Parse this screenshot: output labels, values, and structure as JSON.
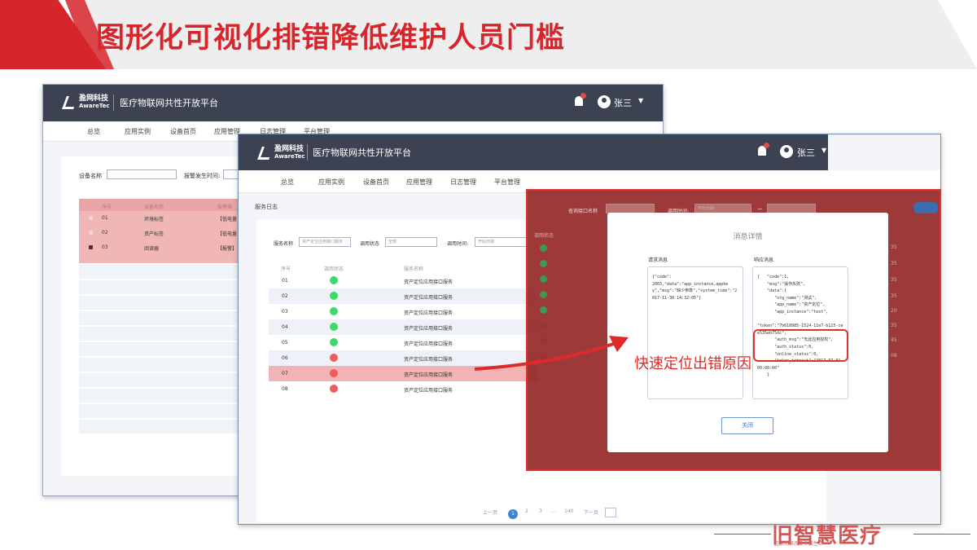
{
  "slide_title": "图形化可视化排错降低维护人员门槛",
  "callout": "快速定位出错原因",
  "colors": {
    "accent_red": "#d6262c",
    "topbar": "#3d4252",
    "status_green": "#3fd86a",
    "status_red": "#ee5c5c",
    "overlay": "#962a2a"
  },
  "app": {
    "logo_cn": "盈网科技",
    "logo_en": "AwareTec",
    "name": "医疗物联网共性开放平台",
    "user": "张三",
    "nav": [
      "总览",
      "应用实例",
      "设备首页",
      "应用管理",
      "日志管理",
      "平台管理"
    ]
  },
  "back_window": {
    "filters": {
      "device_name_label": "设备名称",
      "alarm_time_label": "报警发生时间:"
    },
    "table_headers": [
      "序号",
      "设备名称",
      "报警描"
    ],
    "rows": [
      {
        "no": "01",
        "name": "环境标签",
        "desc": "【低电量"
      },
      {
        "no": "02",
        "name": "资产标签",
        "desc": "【低电量"
      },
      {
        "no": "03",
        "name": "阅读器",
        "desc": "【报警】"
      }
    ]
  },
  "front_window": {
    "breadcrumb": "服务日志",
    "filters": {
      "service_label": "服务名称",
      "service_value": "资产定位应用接口服务",
      "status_label": "调用状态",
      "status_value": "全部",
      "time_label": "调用时间:",
      "time_placeholder": "开始日期"
    },
    "table_headers": [
      "序号",
      "调用状态",
      "服务名称"
    ],
    "rows": [
      {
        "no": "01",
        "status": "ok",
        "name": "资产定位应用接口服务"
      },
      {
        "no": "02",
        "status": "ok",
        "name": "资产定位应用接口服务"
      },
      {
        "no": "03",
        "status": "ok",
        "name": "资产定位应用接口服务"
      },
      {
        "no": "04",
        "status": "ok",
        "name": "资产定位应用接口服务"
      },
      {
        "no": "05",
        "status": "ok",
        "name": "资产定位应用接口服务"
      },
      {
        "no": "06",
        "status": "error",
        "name": "资产定位应用接口服务"
      },
      {
        "no": "07",
        "status": "error",
        "name": "资产定位应用接口服务"
      },
      {
        "no": "08",
        "status": "error",
        "name": "资产定位应用接口服务"
      }
    ],
    "pagination": {
      "prev": "上一页",
      "pages": [
        "1",
        "2",
        "3",
        "...",
        "140"
      ],
      "next": "下一页",
      "current": "1"
    }
  },
  "overlay": {
    "filter_label": "查询接口名称",
    "time_label": "调用时间:",
    "time_placeholder": "开始日期",
    "tilde": "~",
    "status_header": "调用状态",
    "times": [
      "35",
      "35",
      "35",
      "35",
      "20",
      "35",
      "45",
      "08"
    ]
  },
  "modal": {
    "title": "消息详情",
    "request_label": "请求消息",
    "response_label": "响应消息",
    "request_body": "{\"code\":\n2003,\"data\":\"app_instance,appkey\",\"msg\":\"缺少参数\",\"system_time\":\"2017-11-30 14:32:05\"}",
    "response_body": "{   \"code\":1,\n    \"msg\":\"操作失败\",\n    \"data\":{\n       \"org_name\":\"测试\",\n       \"app_name\":\"资产定位\",\n       \"app_instance\":\"test\",\n\n\"token\":\"7b618985-1524-11e7-b125-cee535eb75dc\",\n       \"auth_msg\":\"无此应用授权\",\n       \"auth_status\":0,\n       \"online_status\":0,\n       \"token_timeout\":\"2017-07-01 00:00:00\"\n    }",
    "close_label": "关闭"
  },
  "footer": {
    "brand": "智慧医疗",
    "prefix": "旧",
    "slogan": "互联物联改变你我生活"
  }
}
